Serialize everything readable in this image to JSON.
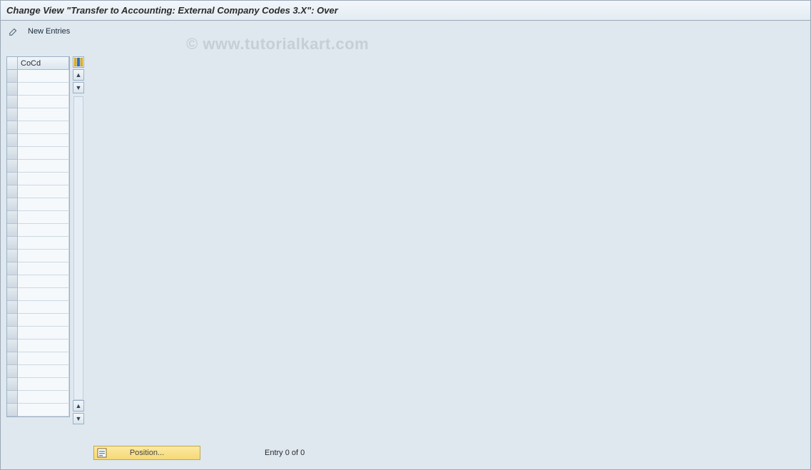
{
  "title": "Change View \"Transfer to Accounting: External Company Codes 3.X\": Over",
  "toolbar": {
    "new_entries_label": "New Entries"
  },
  "watermark": "© www.tutorialkart.com",
  "grid": {
    "header": {
      "row_select": "",
      "cocd": "CoCd"
    },
    "row_count": 27,
    "rows": []
  },
  "side_controls": {
    "select_mode_tooltip": "Select columns",
    "scroll_up_tooltip": "Scroll up",
    "scroll_down_tooltip": "Scroll down"
  },
  "footer": {
    "position_label": "Position...",
    "entry_status": "Entry 0 of 0"
  }
}
